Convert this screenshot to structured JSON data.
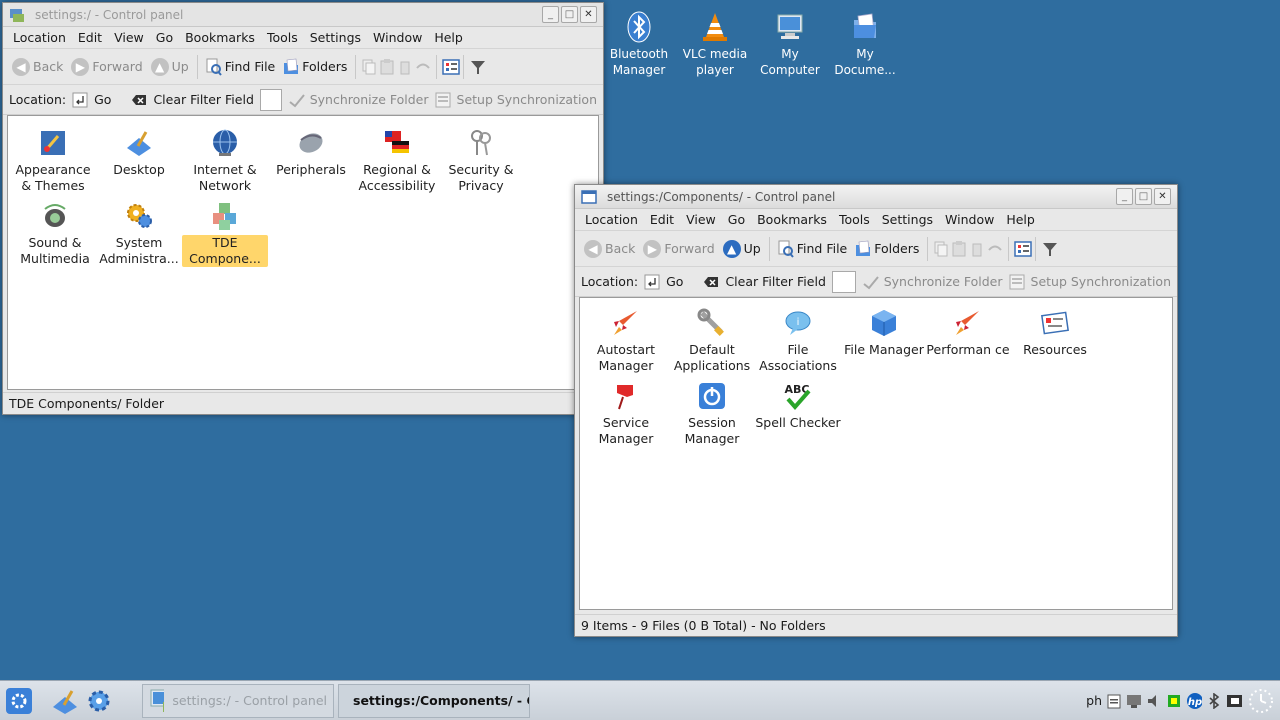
{
  "desktop": {
    "icons": [
      {
        "label": "Bluetooth Manager"
      },
      {
        "label": "VLC media player"
      },
      {
        "label": "My Computer"
      },
      {
        "label": "My Docume..."
      }
    ]
  },
  "window1": {
    "title": "settings:/ - Control panel",
    "menu": [
      "Location",
      "Edit",
      "View",
      "Go",
      "Bookmarks",
      "Tools",
      "Settings",
      "Window",
      "Help"
    ],
    "toolbar": {
      "back": "Back",
      "forward": "Forward",
      "up": "Up",
      "find": "Find File",
      "folders": "Folders"
    },
    "locbar": {
      "location": "Location:",
      "go": "Go",
      "clear": "Clear Filter Field",
      "sync": "Synchronize Folder",
      "setup": "Setup Synchronization"
    },
    "items": [
      {
        "label": "Appearance & Themes"
      },
      {
        "label": "Desktop"
      },
      {
        "label": "Internet & Network"
      },
      {
        "label": "Peripherals"
      },
      {
        "label": "Regional & Accessibility"
      },
      {
        "label": "Security & Privacy"
      },
      {
        "label": "Sound & Multimedia"
      },
      {
        "label": "System Administra..."
      },
      {
        "label": "TDE Compone..."
      }
    ],
    "status": "TDE Components/  Folder"
  },
  "window2": {
    "title": "settings:/Components/ - Control panel",
    "menu": [
      "Location",
      "Edit",
      "View",
      "Go",
      "Bookmarks",
      "Tools",
      "Settings",
      "Window",
      "Help"
    ],
    "toolbar": {
      "back": "Back",
      "forward": "Forward",
      "up": "Up",
      "find": "Find File",
      "folders": "Folders"
    },
    "locbar": {
      "location": "Location:",
      "go": "Go",
      "clear": "Clear Filter Field",
      "sync": "Synchronize Folder",
      "setup": "Setup Synchronization"
    },
    "items": [
      {
        "label": "Autostart Manager"
      },
      {
        "label": "Default Applications"
      },
      {
        "label": "File Associations"
      },
      {
        "label": "File Manager"
      },
      {
        "label": "Performan ce"
      },
      {
        "label": "Resources"
      },
      {
        "label": "Service Manager"
      },
      {
        "label": "Session Manager"
      },
      {
        "label": "Spell Checker"
      }
    ],
    "status": "9 Items - 9 Files (0 B Total) - No Folders"
  },
  "taskbar": {
    "tasks": [
      {
        "label": "settings:/ - Control panel"
      },
      {
        "label": "settings:/Components/ - C"
      }
    ],
    "tray_text": "ph",
    "colors": {
      "desktop": "#2f6d9f",
      "selection": "#ffd66b",
      "accent": "#2c6cc0"
    }
  }
}
